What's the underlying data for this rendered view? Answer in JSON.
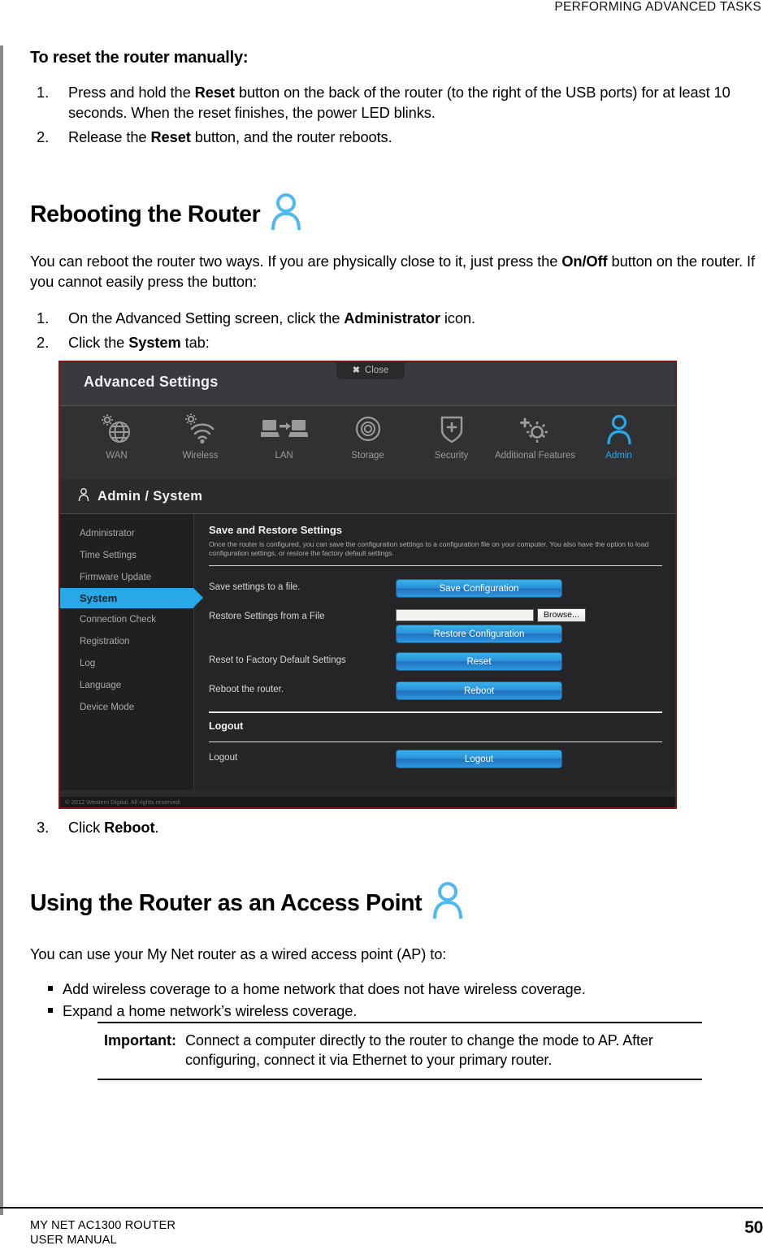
{
  "page": {
    "header": "PERFORMING ADVANCED TASKS",
    "footer_line1": "MY NET AC1300 ROUTER",
    "footer_line2": "USER MANUAL",
    "page_number": "50"
  },
  "reset_section": {
    "heading": "To reset the router manually:",
    "steps": [
      {
        "num": "1.",
        "part1": "Press and hold the ",
        "bold1": "Reset",
        "part2": " button on the back of the router (to the right of the USB ports) for at least 10 seconds. When the reset finishes, the power LED blinks."
      },
      {
        "num": "2.",
        "part1": "Release the ",
        "bold1": "Reset",
        "part2": " button, and the router reboots."
      }
    ]
  },
  "reboot_section": {
    "title": "Rebooting the Router",
    "intro_part1": "You can reboot the router two ways. If you are physically close to it, just press the ",
    "intro_bold": "On/Off",
    "intro_part2": " button on the router. If you cannot easily press the button:",
    "steps": [
      {
        "num": "1.",
        "part1": "On the Advanced Setting screen, click the ",
        "bold1": "Administrator",
        "part2": " icon."
      },
      {
        "num": "2.",
        "part1": "Click the ",
        "bold1": "System",
        "part2": " tab:"
      }
    ],
    "step3": {
      "num": "3.",
      "part1": "Click ",
      "bold1": "Reboot",
      "part2": "."
    }
  },
  "router_ui": {
    "title": "Advanced Settings",
    "close_label": "Close",
    "close_icon": "close-x-icon",
    "nav": [
      {
        "label": "WAN",
        "icon": "globe-gear-icon",
        "active": false
      },
      {
        "label": "Wireless",
        "icon": "wifi-gear-icon",
        "active": false
      },
      {
        "label": "LAN",
        "icon": "computer-to-computer-icon",
        "active": false
      },
      {
        "label": "Storage",
        "icon": "disc-icon",
        "active": false
      },
      {
        "label": "Security",
        "icon": "shield-plus-icon",
        "active": false
      },
      {
        "label": "Additional Features",
        "icon": "gear-plus-icon",
        "active": false
      },
      {
        "label": "Admin",
        "icon": "person-icon",
        "active": true
      }
    ],
    "breadcrumb": "Admin / System",
    "breadcrumb_icon": "person-icon",
    "sidebar": [
      {
        "label": "Administrator",
        "active": false
      },
      {
        "label": "Time Settings",
        "active": false
      },
      {
        "label": "Firmware Update",
        "active": false
      },
      {
        "label": "System",
        "active": true
      },
      {
        "label": "Connection Check",
        "active": false
      },
      {
        "label": "Registration",
        "active": false
      },
      {
        "label": "Log",
        "active": false
      },
      {
        "label": "Language",
        "active": false
      },
      {
        "label": "Device Mode",
        "active": false
      }
    ],
    "main": {
      "heading": "Save and Restore Settings",
      "description": "Once the router is configured, you can save the configuration settings to a configuration file on your computer. You also have the option to load configuration settings, or restore the factory default settings.",
      "rows": [
        {
          "label": "Save settings to a file.",
          "button": "Save Configuration"
        },
        {
          "label": "Restore Settings from a File",
          "button": "Restore Configuration",
          "file_value": "",
          "browse_label": "Browse..."
        },
        {
          "label": "Reset to Factory Default Settings",
          "button": "Reset"
        },
        {
          "label": "Reboot the router.",
          "button": "Reboot"
        }
      ],
      "logout_heading": "Logout",
      "logout_row": {
        "label": "Logout",
        "button": "Logout"
      }
    },
    "copyright": "© 2012 Western Digital. All rights reserved.",
    "accent_color": "#29a8e8",
    "border_color": "#7e1414"
  },
  "ap_section": {
    "title": "Using the Router as an Access Point",
    "intro": "You can use your My Net router as a wired access point (AP) to:",
    "bullets": [
      "Add wireless coverage to a home network that does not have wireless coverage.",
      "Expand a home network’s wireless coverage."
    ],
    "note_label": "Important:",
    "note_text": "Connect a computer directly to the router to change the mode to AP. After configuring, connect it via Ethernet to your primary router."
  }
}
